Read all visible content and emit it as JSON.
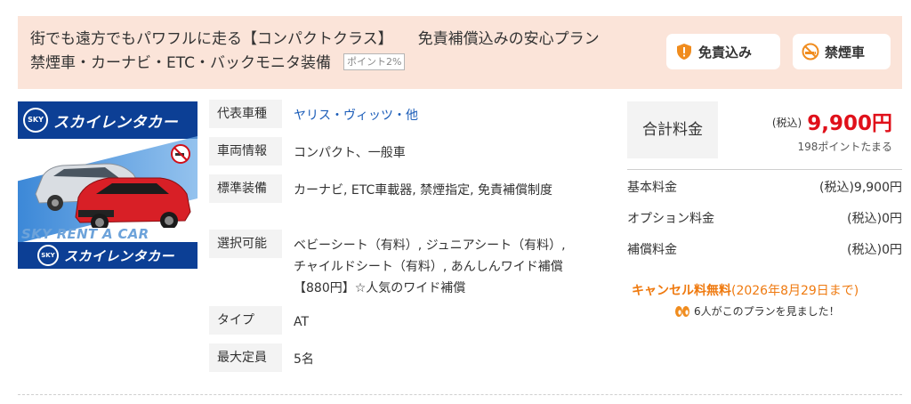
{
  "header": {
    "title_line1_a": "街でも遠方でもパワフルに走る【コンパクトクラス】",
    "title_line1_b": "免責補償込みの安心プラン",
    "title_line2": "禁煙車・カーナビ・ETC・バックモニタ装備",
    "point_badge": "ポイント2%",
    "tags": [
      {
        "label": "免責込み",
        "icon": "shield-icon",
        "color": "#f08c1e"
      },
      {
        "label": "禁煙車",
        "icon": "no-smoking-icon",
        "color": "#f08c1e"
      }
    ]
  },
  "car_image": {
    "logo_text": "SKY",
    "brand_text": "スカイレンタカー",
    "watermark": "SKY RENT A CAR",
    "brand_color": "#0c3f95"
  },
  "details": [
    {
      "label": "代表車種",
      "value": "ヤリス・ヴィッツ・他",
      "is_link": true
    },
    {
      "label": "車両情報",
      "value": "コンパクト、一般車",
      "is_link": false
    },
    {
      "label": "標準装備",
      "value": "カーナビ, ETC車載器, 禁煙指定, 免責補償制度",
      "is_link": false
    },
    {
      "label": "選択可能",
      "value": "ベビーシート（有料）, ジュニアシート（有料）, チャイルドシート（有料）, あんしんワイド補償【880円】☆人気のワイド補償",
      "is_link": false
    },
    {
      "label": "タイプ",
      "value": "AT",
      "is_link": false
    },
    {
      "label": "最大定員",
      "value": "5名",
      "is_link": false
    }
  ],
  "pricing": {
    "total_label": "合計料金",
    "tax_label": "(税込)",
    "total_amount": "9,900円",
    "points_text": "198ポイントたまる",
    "price_color": "#e0101a",
    "rows": [
      {
        "label": "基本料金",
        "value": "(税込)9,900円"
      },
      {
        "label": "オプション料金",
        "value": "(税込)0円"
      },
      {
        "label": "補償料金",
        "value": "(税込)0円"
      }
    ],
    "cancel_free": "キャンセル料無料",
    "cancel_until": "(2026年8月29日まで)",
    "cancel_color": "#ef7a10",
    "viewers_text": "6人がこのプランを見ました！"
  }
}
